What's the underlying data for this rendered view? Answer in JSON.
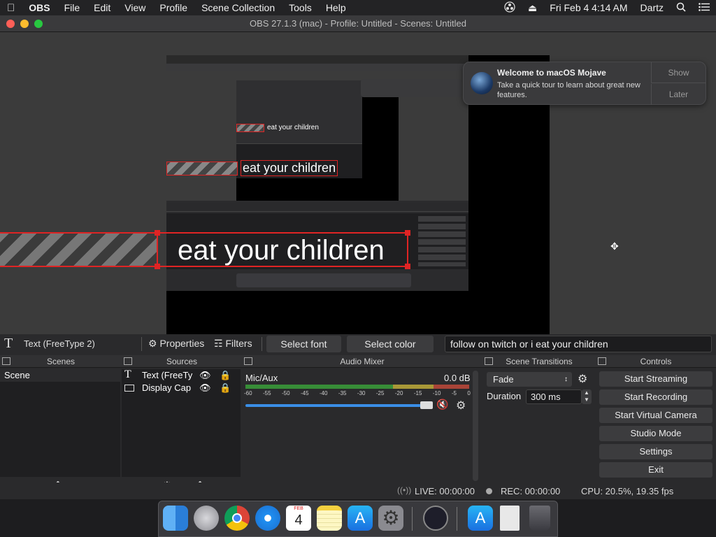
{
  "menubar": {
    "apple_icon": "apple-icon",
    "app_name": "OBS",
    "items": [
      "File",
      "Edit",
      "View",
      "Profile",
      "Scene Collection",
      "Tools",
      "Help"
    ],
    "datetime": "Fri Feb 4  4:14 AM",
    "user": "Dartz"
  },
  "window": {
    "title": "OBS 27.1.3 (mac) - Profile: Untitled - Scenes: Untitled"
  },
  "preview": {
    "overlay_text_small": "eat your children",
    "overlay_text_medium": "eat your children",
    "overlay_text_large": "eat your children"
  },
  "notification": {
    "title": "Welcome to macOS Mojave",
    "body": "Take a quick tour to learn about great new features.",
    "show_label": "Show",
    "later_label": "Later"
  },
  "source_toolbar": {
    "source_name": "Text (FreeType 2)",
    "properties_label": "Properties",
    "filters_label": "Filters",
    "select_font_label": "Select font",
    "select_color_label": "Select color",
    "text_value": "follow on twitch or i eat your children"
  },
  "scenes": {
    "title": "Scenes",
    "items": [
      "Scene"
    ]
  },
  "sources": {
    "title": "Sources",
    "items": [
      "Text (FreeTy",
      "Display Cap"
    ]
  },
  "audio_mixer": {
    "title": "Audio Mixer",
    "channel": "Mic/Aux",
    "level": "0.0 dB",
    "ticks": [
      "-60",
      "-55",
      "-50",
      "-45",
      "-40",
      "-35",
      "-30",
      "-25",
      "-20",
      "-15",
      "-10",
      "-5",
      "0"
    ]
  },
  "transitions": {
    "title": "Scene Transitions",
    "selected": "Fade",
    "duration_label": "Duration",
    "duration_value": "300 ms"
  },
  "controls": {
    "title": "Controls",
    "start_streaming": "Start Streaming",
    "start_recording": "Start Recording",
    "start_virtual_camera": "Start Virtual Camera",
    "studio_mode": "Studio Mode",
    "settings": "Settings",
    "exit": "Exit"
  },
  "status": {
    "live": "LIVE: 00:00:00",
    "rec": "REC: 00:00:00",
    "cpu": "CPU: 20.5%, 19.35 fps"
  },
  "dock": {
    "calendar_month": "FEB",
    "calendar_day": "4"
  },
  "colors": {
    "accent_red": "#e02424",
    "meter_green": "#3aa63a",
    "meter_yellow": "#c8b43a",
    "slider_blue": "#3a8ee6"
  }
}
